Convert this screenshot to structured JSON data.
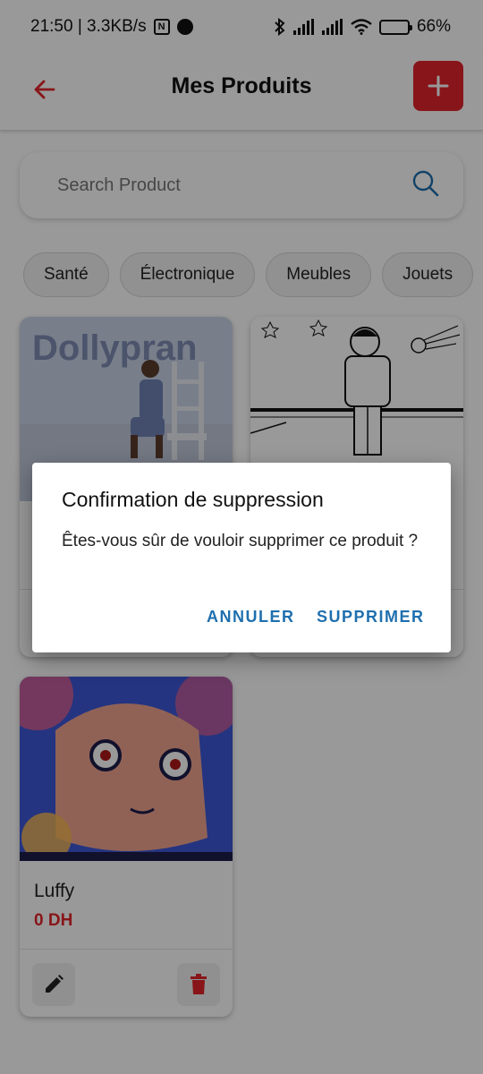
{
  "status_bar": {
    "time_speed": "21:50 | 3.3KB/s",
    "nfc_label": "N",
    "battery_percent": "66%",
    "battery_level": 0.66,
    "icons": [
      "nfc-icon",
      "app-notification-icon",
      "bluetooth-icon",
      "signal-icon",
      "signal-icon",
      "wifi-icon",
      "battery-icon"
    ]
  },
  "app_bar": {
    "title": "Mes Produits",
    "back_icon": "arrow-left-icon",
    "add_icon": "plus-icon"
  },
  "search": {
    "placeholder": "Search Product",
    "value": "",
    "icon": "search-icon"
  },
  "categories": [
    "Santé",
    "Électronique",
    "Meubles",
    "Jouets"
  ],
  "products": [
    {
      "name": "",
      "price": "",
      "image": "person-on-chair-poster-image",
      "image_text": "Dollypran"
    },
    {
      "name": "",
      "price": "",
      "image": "cartoon-boy-looking-at-comet-image"
    },
    {
      "name": "Luffy",
      "price": "0 DH",
      "image": "anime-character-image"
    }
  ],
  "colors": {
    "accent": "#e3242b",
    "dialog_button": "#1f6fae",
    "scrim": "rgba(0,0,0,0.4)"
  },
  "dialog": {
    "title": "Confirmation de suppression",
    "message": "Êtes-vous sûr de vouloir supprimer ce produit ?",
    "cancel_label": "ANNULER",
    "confirm_label": "SUPPRIMER"
  }
}
